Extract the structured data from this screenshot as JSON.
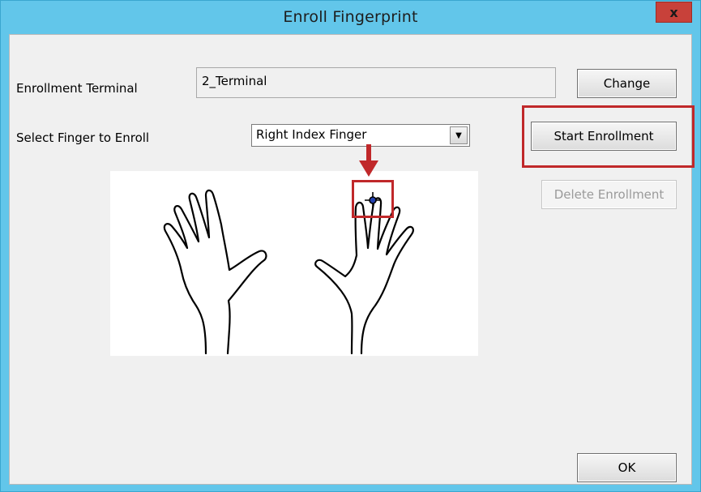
{
  "window": {
    "title": "Enroll Fingerprint",
    "close_label": "x"
  },
  "form": {
    "enrollment_terminal_label": "Enrollment Terminal",
    "enrollment_terminal_value": "2_Terminal",
    "select_finger_label": "Select Finger to Enroll",
    "selected_finger": "Right Index Finger"
  },
  "buttons": {
    "change": "Change",
    "start_enrollment": "Start Enrollment",
    "delete_enrollment": "Delete Enrollment",
    "ok": "OK"
  },
  "colors": {
    "title_bar": "#62c6ea",
    "highlight": "#c0282a",
    "close_button": "#c8413a"
  },
  "icons": {
    "dropdown": "chevron-down-icon",
    "close": "close-icon",
    "marker": "crosshair-icon"
  }
}
